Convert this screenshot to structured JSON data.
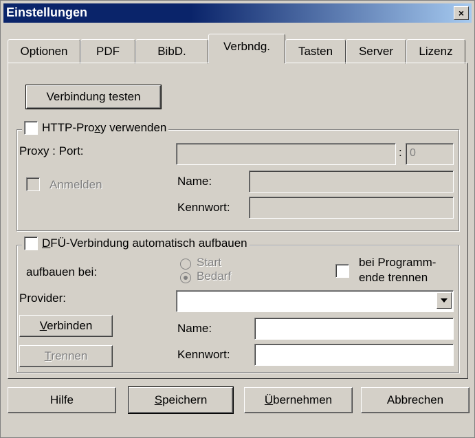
{
  "window": {
    "title": "Einstellungen",
    "close_label": "×"
  },
  "tabs": [
    "Optionen",
    "PDF",
    "BibD.",
    "Verbndg.",
    "Tasten",
    "Server",
    "Lizenz"
  ],
  "active_tab": "Verbndg.",
  "test_button": "Verbindung testen",
  "proxy": {
    "legend_prefix": "HTTP-Pro",
    "legend_ul": "x",
    "legend_suffix": "y verwenden",
    "proxy_port_label": "Proxy : Port:",
    "port_sep": ":",
    "port_value": "0",
    "anmelden_label": "Anmelden",
    "name_label": "Name:",
    "kennwort_label": "Kennwort:"
  },
  "dfu": {
    "legend_ul": "D",
    "legend_suffix": "FÜ-Verbindung automatisch aufbauen",
    "aufbauen_label": "aufbauen bei:",
    "radio_start": "Start",
    "radio_bedarf": "Bedarf",
    "disconnect_line1": "bei Programm-",
    "disconnect_line2": "ende trennen",
    "provider_label": "Provider:",
    "verbinden_ul": "V",
    "verbinden_rest": "erbinden",
    "trennen_ul": "T",
    "trennen_rest": "rennen",
    "name_label": "Name:",
    "kennwort_label": "Kennwort:"
  },
  "footer": {
    "hilfe": "Hilfe",
    "speichern_ul": "S",
    "speichern_rest": "peichern",
    "uebernehmen_ul": "Ü",
    "uebernehmen_rest": "bernehmen",
    "abbrechen": "Abbrechen"
  }
}
